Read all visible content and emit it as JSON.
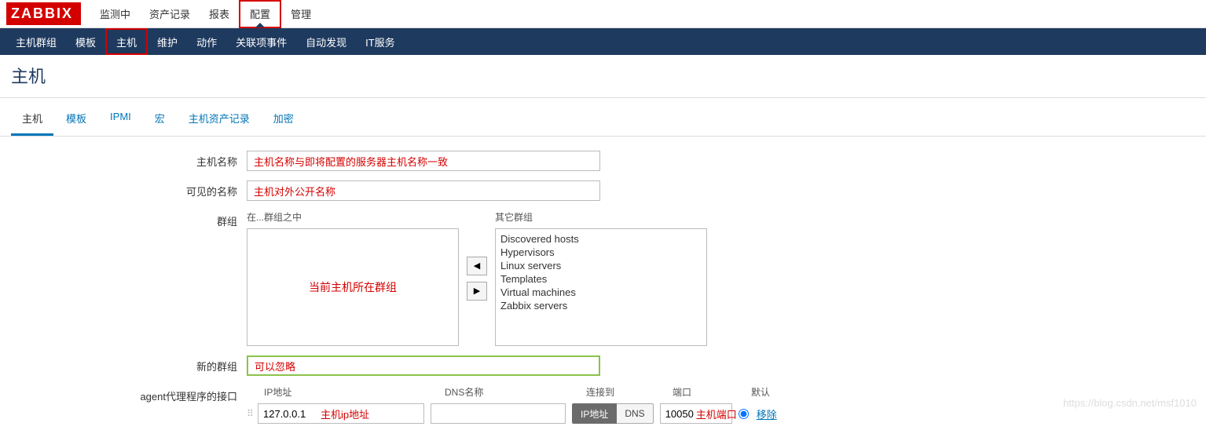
{
  "logo": "ZABBIX",
  "topNav": {
    "items": [
      "监测中",
      "资产记录",
      "报表",
      "配置",
      "管理"
    ],
    "activeIndex": 3
  },
  "subNav": {
    "items": [
      "主机群组",
      "模板",
      "主机",
      "维护",
      "动作",
      "关联项事件",
      "自动发现",
      "IT服务"
    ],
    "activeIndex": 2
  },
  "pageTitle": "主机",
  "tabs": {
    "items": [
      "主机",
      "模板",
      "IPMI",
      "宏",
      "主机资产记录",
      "加密"
    ],
    "activeIndex": 0
  },
  "form": {
    "hostNameLabel": "主机名称",
    "hostNameValue": "主机名称与即将配置的服务器主机名称一致",
    "visibleNameLabel": "可见的名称",
    "visibleNameValue": "主机对外公开名称",
    "groupsLabel": "群组",
    "inGroupsHeader": "在...群组之中",
    "inGroupsPlaceholder": "当前主机所在群组",
    "otherGroupsHeader": "其它群组",
    "otherGroups": [
      "Discovered hosts",
      "Hypervisors",
      "Linux servers",
      "Templates",
      "Virtual machines",
      "Zabbix servers"
    ],
    "arrowLeft": "◀",
    "arrowRight": "▶",
    "newGroupLabel": "新的群组",
    "newGroupValue": "可以忽略",
    "agentIfaceLabel": "agent代理程序的接口",
    "cols": {
      "ip": "IP地址",
      "dns": "DNS名称",
      "conn": "连接到",
      "port": "端口",
      "def": "默认"
    },
    "iface": {
      "ip": "127.0.0.1",
      "ipNote": "主机ip地址",
      "dns": "",
      "connIp": "IP地址",
      "connDns": "DNS",
      "port": "10050",
      "portNote": "主机端口",
      "remove": "移除"
    }
  },
  "watermark": "https://blog.csdn.net/msf1010"
}
